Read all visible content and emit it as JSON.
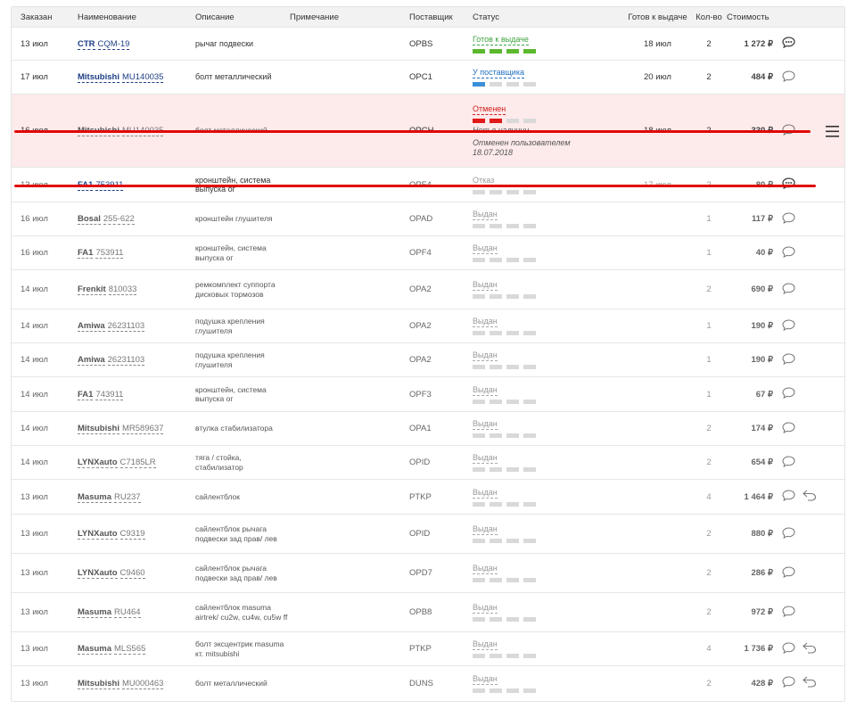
{
  "columns": {
    "ordered": "Заказан",
    "name": "Наименование",
    "description": "Описание",
    "note": "Примечание",
    "supplier": "Поставщик",
    "status": "Статус",
    "ready": "Готов к выдаче",
    "qty": "Кол-во",
    "cost": "Стоимость"
  },
  "rows": [
    {
      "date": "13 июл",
      "brand": "CTR",
      "part": "CQM-19",
      "desc": "рычаг подвески",
      "supplier": "OPBS",
      "status": "Готов к выдаче",
      "status_color": "#3fa33f",
      "ready": "18 июл",
      "qty": "2",
      "cost": "1 272 ₽",
      "comment": "filled"
    },
    {
      "date": "17 июл",
      "brand": "Mitsubishi",
      "part": "MU140035",
      "desc": "болт металлический",
      "supplier": "OPC1",
      "status": "У поставщика",
      "status_color": "#1e6fc1",
      "ready": "20 июл",
      "qty": "2",
      "cost": "484 ₽",
      "comment": "outline"
    },
    {
      "date": "16 июл",
      "brand": "Mitsubishi",
      "part": "MU140035",
      "desc": "болт металлический",
      "supplier": "OPCH",
      "status": "Отменен",
      "status_color": "#d32020",
      "status_extra1": "Нет в наличии",
      "status_extra2": "Отменен пользователем 18.07.2018",
      "ready": "18 июл",
      "qty": "2",
      "cost": "330 ₽",
      "comment": "outline"
    },
    {
      "date": "13 июл",
      "brand": "FA1",
      "part": "753911",
      "desc": "кронштейн, система выпуска ог",
      "supplier": "OPF4",
      "status": "Отказ",
      "status_color": "#999999",
      "ready": "17 июл",
      "qty": "2",
      "cost": "80 ₽",
      "comment": "filled"
    },
    {
      "date": "16 июл",
      "brand": "Bosal",
      "part": "255-622",
      "desc": "кронштейн глушителя",
      "supplier": "OPAD",
      "status": "Выдан",
      "ready": "",
      "qty": "1",
      "cost": "117 ₽",
      "comment": "outline"
    },
    {
      "date": "16 июл",
      "brand": "FA1",
      "part": "753911",
      "desc": "кронштейн, система выпуска ог",
      "supplier": "OPF4",
      "status": "Выдан",
      "ready": "",
      "qty": "1",
      "cost": "40 ₽",
      "comment": "outline"
    },
    {
      "date": "14 июл",
      "brand": "Frenkit",
      "part": "810033",
      "desc": "ремкомплект суппорта дисковых тормозов",
      "supplier": "OPA2",
      "status": "Выдан",
      "ready": "",
      "qty": "2",
      "cost": "690 ₽",
      "comment": "outline"
    },
    {
      "date": "14 июл",
      "brand": "Amiwa",
      "part": "26231103",
      "desc": "подушка крепления глушителя",
      "supplier": "OPA2",
      "status": "Выдан",
      "ready": "",
      "qty": "1",
      "cost": "190 ₽",
      "comment": "outline"
    },
    {
      "date": "14 июл",
      "brand": "Amiwa",
      "part": "26231103",
      "desc": "подушка крепления глушителя",
      "supplier": "OPA2",
      "status": "Выдан",
      "ready": "",
      "qty": "1",
      "cost": "190 ₽",
      "comment": "outline"
    },
    {
      "date": "14 июл",
      "brand": "FA1",
      "part": "743911",
      "desc": "кронштейн, система выпуска ог",
      "supplier": "OPF3",
      "status": "Выдан",
      "ready": "",
      "qty": "1",
      "cost": "67 ₽",
      "comment": "outline"
    },
    {
      "date": "14 июл",
      "brand": "Mitsubishi",
      "part": "MR589637",
      "desc": "втулка стабилизатора",
      "supplier": "OPA1",
      "status": "Выдан",
      "ready": "",
      "qty": "2",
      "cost": "174 ₽",
      "comment": "outline"
    },
    {
      "date": "14 июл",
      "brand": "LYNXauto",
      "part": "C7185LR",
      "desc": "тяга / стойка, стабилизатор",
      "supplier": "OPID",
      "status": "Выдан",
      "ready": "",
      "qty": "2",
      "cost": "654 ₽",
      "comment": "outline"
    },
    {
      "date": "13 июл",
      "brand": "Masuma",
      "part": "RU237",
      "desc": "сайлентблок",
      "supplier": "PTKP",
      "status": "Выдан",
      "ready": "",
      "qty": "4",
      "cost": "1 464 ₽",
      "comment": "outline",
      "return": true
    },
    {
      "date": "13 июл",
      "brand": "LYNXauto",
      "part": "C9319",
      "desc": "сайлентблок рычага подвески зад прав/ лев",
      "supplier": "OPID",
      "status": "Выдан",
      "ready": "",
      "qty": "2",
      "cost": "880 ₽",
      "comment": "outline"
    },
    {
      "date": "13 июл",
      "brand": "LYNXauto",
      "part": "C9460",
      "desc": "сайлентблок рычага подвески зад прав/ лев",
      "supplier": "OPD7",
      "status": "Выдан",
      "ready": "",
      "qty": "2",
      "cost": "286 ₽",
      "comment": "outline"
    },
    {
      "date": "13 июл",
      "brand": "Masuma",
      "part": "RU464",
      "desc": "сайлентблок masuma airtrek/ cu2w, cu4w, cu5w ff",
      "supplier": "OPB8",
      "status": "Выдан",
      "ready": "",
      "qty": "2",
      "cost": "972 ₽",
      "comment": "outline"
    },
    {
      "date": "13 июл",
      "brand": "Masuma",
      "part": "MLS565",
      "desc": "болт эксцентрик masuma кт. mitsubishi",
      "supplier": "PTKP",
      "status": "Выдан",
      "ready": "",
      "qty": "4",
      "cost": "1 736 ₽",
      "comment": "outline",
      "return": true
    },
    {
      "date": "13 июл",
      "brand": "Mitsubishi",
      "part": "MU000463",
      "desc": "болт металлический",
      "supplier": "DUNS",
      "status": "Выдан",
      "ready": "",
      "qty": "2",
      "cost": "428 ₽",
      "comment": "outline",
      "return": true
    }
  ],
  "colors": {
    "canceled_row_bg": "#fdeaea",
    "strike_line": "#e10808",
    "brand_link": "#1e3f86"
  },
  "icons": {
    "comment": "comment-bubble-icon",
    "return": "return-arrow-icon",
    "menu": "hamburger-menu-icon"
  }
}
